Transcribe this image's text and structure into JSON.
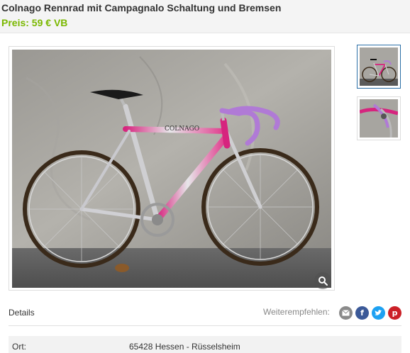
{
  "listing": {
    "title": "Colnago Rennrad mit Campagnalo Schaltung und Bremsen",
    "price": "Preis: 59 € VB"
  },
  "gallery": {
    "main_image_alt": "Colnago road bike, pink and silver frame",
    "thumbnails": [
      {
        "name": "thumbnail-1",
        "active": true
      },
      {
        "name": "thumbnail-2",
        "active": false
      }
    ],
    "zoom_icon": "magnifier-icon"
  },
  "details": {
    "label": "Details",
    "share_label": "Weiterempfehlen:",
    "share_icons": [
      "email-icon",
      "facebook-icon",
      "twitter-icon",
      "pinterest-icon"
    ],
    "rows": [
      {
        "label": "Ort:",
        "value": "65428 Hessen - Rüsselsheim"
      }
    ]
  },
  "colors": {
    "price": "#7ab800",
    "thumbnail_active_border": "#2a6ea6",
    "facebook": "#3b5998",
    "twitter": "#1da1f2",
    "pinterest": "#cb2027"
  }
}
